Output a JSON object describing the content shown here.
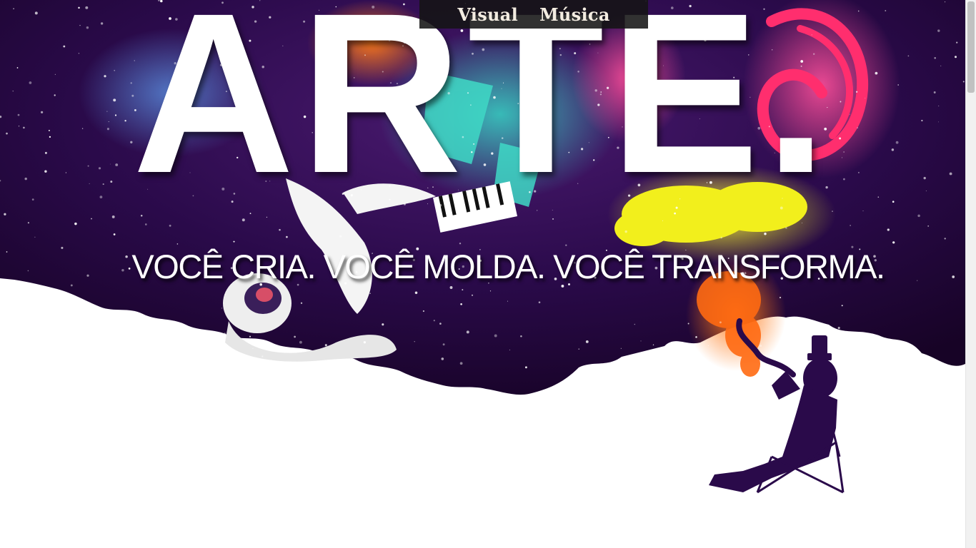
{
  "nav": {
    "items": [
      {
        "label": "Visual"
      },
      {
        "label": "Música"
      }
    ]
  },
  "hero": {
    "title": "ARTE.",
    "tagline": "VOCÊ CRIA. VOCÊ MOLDA. VOCÊ TRANSFORMA."
  },
  "colors": {
    "space": "#2a0a4a",
    "space_dark": "#170326",
    "page_bg": "#ffffff",
    "nav_bg": "#141414",
    "nav_text": "#f3ece1"
  },
  "scrollbar": {
    "position_fraction": 0.0
  }
}
